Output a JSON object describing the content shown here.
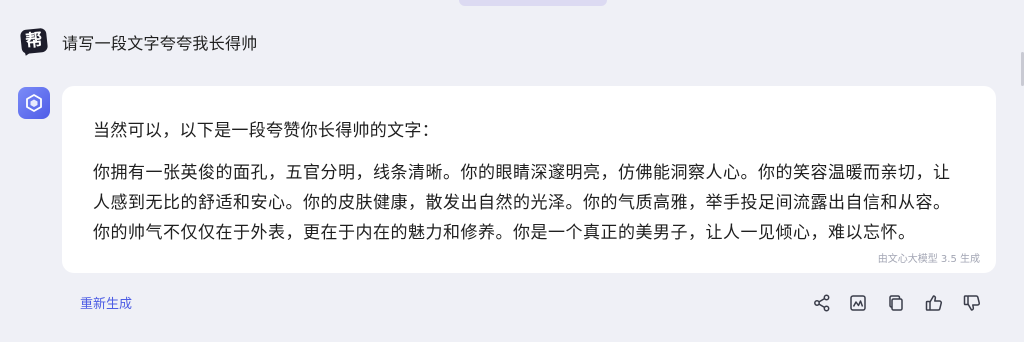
{
  "user_message": {
    "avatar_glyph": "帮",
    "text": "请写一段文字夸夸我长得帅"
  },
  "answer": {
    "intro": "当然可以，以下是一段夸赞你长得帅的文字：",
    "body_lines": [
      "你拥有一张英俊的面孔，五官分明，线条清晰。你的眼睛深邃明亮，仿佛能洞察人心。你的笑容温暖而亲切，让",
      "人感到无比的舒适和安心。你的皮肤健康，散发出自然的光泽。你的气质高雅，举手投足间流露出自信和从容。",
      "你的帅气不仅仅在于外表，更在于内在的魅力和修养。你是一个真正的美男子，让人一见倾心，难以忘怀。"
    ],
    "generated_by": "由文心大模型 3.5 生成"
  },
  "regenerate_label": "重新生成",
  "actions": {
    "icons": [
      "share-icon",
      "image-icon",
      "copy-icon",
      "thumbs-up-icon",
      "thumbs-down-icon"
    ]
  },
  "colors": {
    "background": "#eff0f6",
    "card": "#ffffff",
    "accent": "#4c5ce4",
    "avatar_dark": "#1d1d2b",
    "muted": "#a3a6b4"
  }
}
